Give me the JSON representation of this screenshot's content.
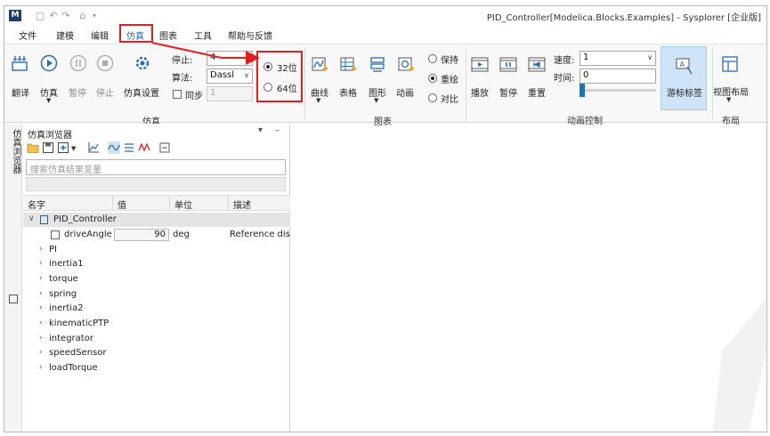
{
  "window": {
    "app_logo": "M",
    "title": "PID_Controller[Modelica.Blocks.Examples] - Sysplorer [企业版]"
  },
  "menu": {
    "items": [
      "文件",
      "建模",
      "编辑",
      "仿真",
      "图表",
      "工具",
      "帮助与反馈"
    ],
    "active": "仿真"
  },
  "ribbon": {
    "sim_group": {
      "label": "仿真",
      "buttons": [
        "翻译",
        "仿真",
        "暂停",
        "停止",
        "仿真设置"
      ]
    },
    "params": {
      "stop_label": "停止:",
      "stop_value": "4",
      "algo_label": "算法:",
      "algo_value": "Dassl",
      "step_label": "同步",
      "step_value": "1"
    },
    "bits": {
      "option_32": "32位",
      "option_64": "64位",
      "selected": "32位"
    },
    "chart_group": {
      "label": "图表",
      "buttons": [
        "曲线",
        "表格",
        "图形",
        "动画"
      ]
    },
    "mode": {
      "options": [
        "保持",
        "重绘",
        "对比"
      ],
      "selected": "重绘"
    },
    "anim_group": {
      "label": "动画控制",
      "buttons": [
        "播放",
        "暂停",
        "重置"
      ],
      "speed_label": "速度:",
      "speed_value": "1",
      "time_label": "时间:",
      "time_value": "0",
      "cursor_label": "游标标签"
    },
    "layout_group": {
      "label": "布局",
      "button": "视图布局"
    }
  },
  "side_tab": "仿真浏览器",
  "browser": {
    "title": "仿真浏览器",
    "search_placeholder": "搜索仿真结果变量",
    "columns": [
      "名字",
      "值",
      "单位",
      "描述"
    ],
    "root": "PID_Controller",
    "param_row": {
      "name": "driveAngle",
      "value": "90",
      "unit": "deg",
      "description": "Reference dis"
    },
    "components": [
      "PI",
      "inertia1",
      "torque",
      "spring",
      "inertia2",
      "kinematicPTP",
      "integrator",
      "speedSensor",
      "loadTorque"
    ]
  },
  "colors": {
    "highlight_red": "#e02020",
    "accent_blue": "#1e73be"
  }
}
